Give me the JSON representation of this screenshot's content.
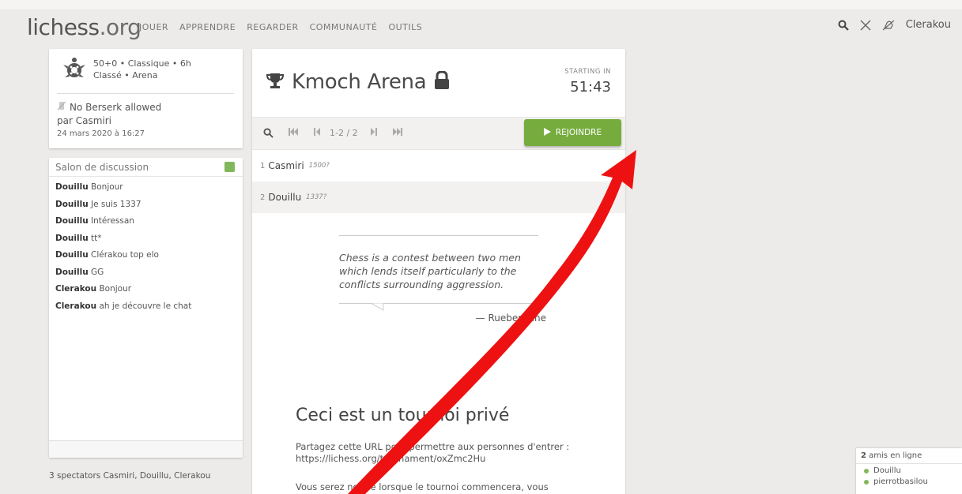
{
  "header": {
    "logo_main": "lichess",
    "logo_tld": ".org",
    "nav": [
      "JOUER",
      "APPRENDRE",
      "REGARDER",
      "COMMUNAUTÉ",
      "OUTILS"
    ],
    "username": "Clerakou"
  },
  "tournament_info": {
    "line1": "50+0 • Classique • 6h",
    "line2": "Classé • Arena",
    "berserk": "No Berserk allowed",
    "by": "par Casmiri",
    "date": "24 mars 2020 à 16:27"
  },
  "chat": {
    "title": "Salon de discussion",
    "messages": [
      {
        "user": "Douillu",
        "text": "Bonjour"
      },
      {
        "user": "Douillu",
        "text": "Je suis 1337"
      },
      {
        "user": "Douillu",
        "text": "Intéressan"
      },
      {
        "user": "Douillu",
        "text": "tt*"
      },
      {
        "user": "Douillu",
        "text": "Clérakou top elo"
      },
      {
        "user": "Douillu",
        "text": "GG"
      },
      {
        "user": "Clerakou",
        "text": "Bonjour"
      },
      {
        "user": "Clerakou",
        "text": "ah je découvre le chat"
      }
    ],
    "spectators": "3 spectators Casmiri, Douillu, Clerakou"
  },
  "main": {
    "title": "Kmoch Arena",
    "starting_label": "STARTING IN",
    "countdown": "51:43",
    "pager_range": "1-2 / 2",
    "join_label": "REJOINDRE",
    "players": [
      {
        "rank": "1",
        "name": "Casmiri",
        "rating": "1500?"
      },
      {
        "rank": "2",
        "name": "Douillu",
        "rating": "1337?"
      }
    ],
    "quote": {
      "text": "Chess is a contest between two men which lends itself particularly to the conflicts surrounding aggression.",
      "author": "— Rueben Fine"
    },
    "private": {
      "title": "Ceci est un tournoi privé",
      "desc": "Partagez cette URL pour permettre aux personnes d'entrer :",
      "url": "https://lichess.org/tournament/oxZmc2Hu",
      "note": "Vous serez notifié lorsque le tournoi commencera, vous"
    }
  },
  "friends": {
    "count": "2",
    "label": "amis en ligne",
    "list": [
      "Douillu",
      "pierrotbasilou"
    ]
  },
  "colors": {
    "accent_green": "#76ac3e",
    "annotation_red": "#ee1111"
  }
}
